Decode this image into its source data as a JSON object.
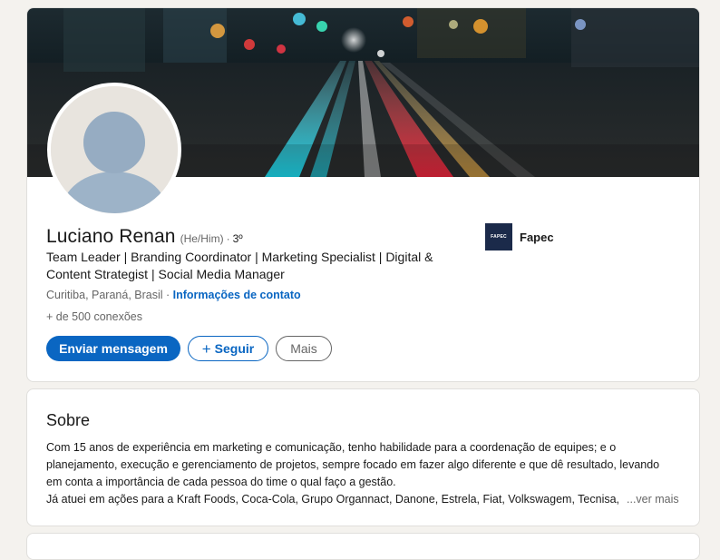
{
  "profile": {
    "name": "Luciano Renan",
    "pronouns": "(He/Him)",
    "separator": "·",
    "degree": "3º",
    "headline_line1": "Team Leader | Branding Coordinator | Marketing Specialist | Digital &",
    "headline_line2": "Content Strategist | Social Media Manager",
    "location": "Curitiba, Paraná, Brasil",
    "location_separator": " · ",
    "contact_info": "Informações de contato",
    "connections": "+ de 500 conexões"
  },
  "actions": {
    "message": "Enviar mensagem",
    "follow_plus": "+",
    "follow": "Seguir",
    "more": "Mais"
  },
  "company": {
    "logo_text": "FAPEC",
    "name": "Fapec"
  },
  "about": {
    "title": "Sobre",
    "line1": "Com 15 anos de experiência em marketing e comunicação, tenho habilidade para a coordenação de equipes; e o",
    "line2": "planejamento, execução e gerenciamento de projetos, sempre focado em fazer algo diferente e que dê resultado, levando",
    "line3": "em conta a importância de cada pessoa do time o qual faço a gestão.",
    "line4": "Já atuei em ações para a Kraft Foods, Coca-Cola, Grupo Organnact, Danone, Estrela, Fiat, Volkswagem, Tecnisa, I",
    "see_more": "...ver mais"
  },
  "colors": {
    "accent": "#0a66c2",
    "page_bg": "#f4f2ee",
    "muted_text": "#666666"
  }
}
